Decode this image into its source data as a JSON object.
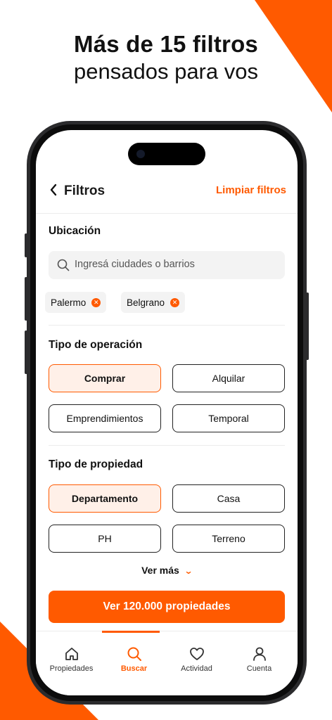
{
  "headline": {
    "line1": "Más de 15 filtros",
    "line2": "pensados para vos"
  },
  "header": {
    "back_icon": "chevron-left-icon",
    "title": "Filtros",
    "clear_label": "Limpiar filtros"
  },
  "location": {
    "title": "Ubicación",
    "search_placeholder": "Ingresá ciudades o barrios",
    "chips": [
      "Palermo",
      "Belgrano"
    ]
  },
  "operation": {
    "title": "Tipo de operación",
    "options": [
      "Comprar",
      "Alquilar",
      "Emprendimientos",
      "Temporal"
    ],
    "selected": "Comprar"
  },
  "property": {
    "title": "Tipo de propiedad",
    "options": [
      "Departamento",
      "Casa",
      "PH",
      "Terreno"
    ],
    "selected": "Departamento",
    "more_label": "Ver más"
  },
  "cta_label": "Ver 120.000 propiedades",
  "tabs": [
    {
      "label": "Propiedades",
      "icon": "home-icon"
    },
    {
      "label": "Buscar",
      "icon": "search-icon",
      "active": true
    },
    {
      "label": "Actividad",
      "icon": "heart-icon"
    },
    {
      "label": "Cuenta",
      "icon": "user-icon"
    }
  ],
  "colors": {
    "accent": "#ff5a00",
    "selected_bg": "#fff0e8"
  }
}
